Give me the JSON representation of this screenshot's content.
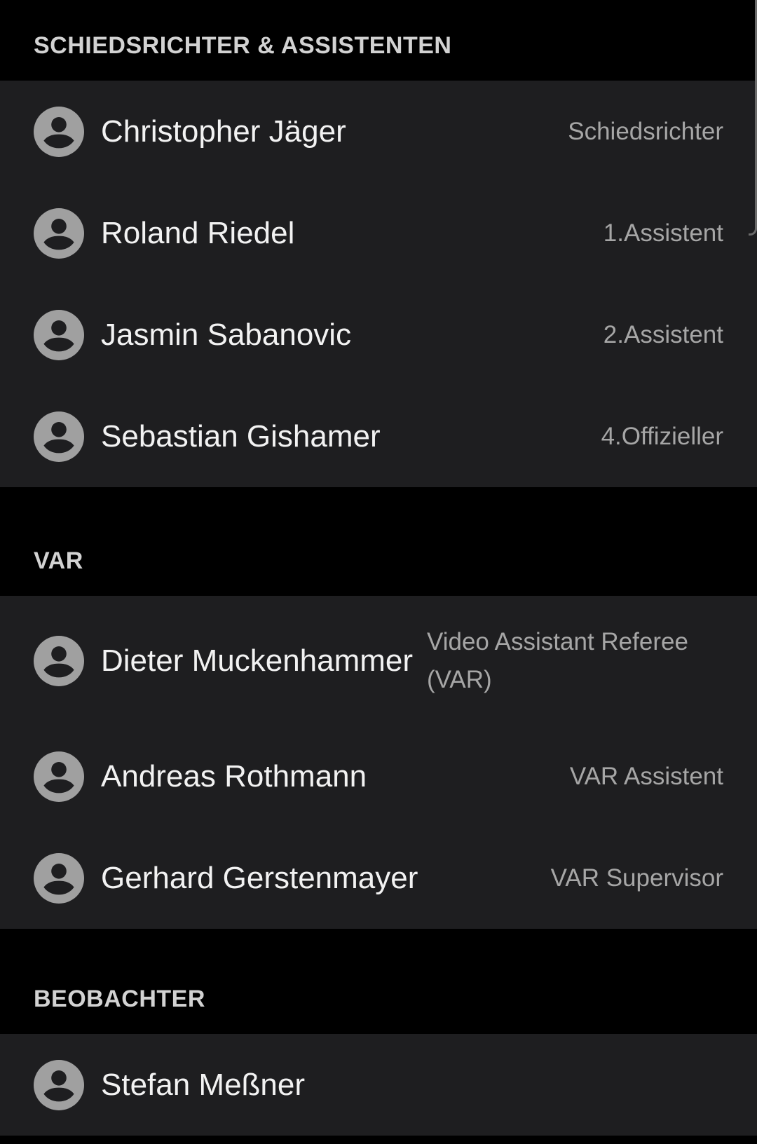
{
  "sections": [
    {
      "title": "SCHIEDSRICHTER & ASSISTENTEN",
      "people": [
        {
          "name": "Christopher Jäger",
          "role": "Schiedsrichter"
        },
        {
          "name": "Roland Riedel",
          "role": "1.Assistent"
        },
        {
          "name": "Jasmin Sabanovic",
          "role": "2.Assistent"
        },
        {
          "name": "Sebastian Gishamer",
          "role": "4.Offizieller"
        }
      ]
    },
    {
      "title": "VAR",
      "people": [
        {
          "name": "Dieter Muckenhammer",
          "role": "Video Assistant Referee (VAR)"
        },
        {
          "name": "Andreas Rothmann",
          "role": "VAR Assistent"
        },
        {
          "name": "Gerhard Gerstenmayer",
          "role": "VAR Supervisor"
        }
      ]
    },
    {
      "title": "BEOBACHTER",
      "people": [
        {
          "name": "Stefan Meßner",
          "role": ""
        }
      ]
    }
  ],
  "colors": {
    "background": "#000000",
    "card": "#1e1e20",
    "avatar": "#a0a0a0",
    "header_text": "#d2d2d2",
    "name_text": "#f2f2f2",
    "role_text": "#a6a6a6"
  },
  "icons": {
    "avatar": "person-circle-icon"
  }
}
